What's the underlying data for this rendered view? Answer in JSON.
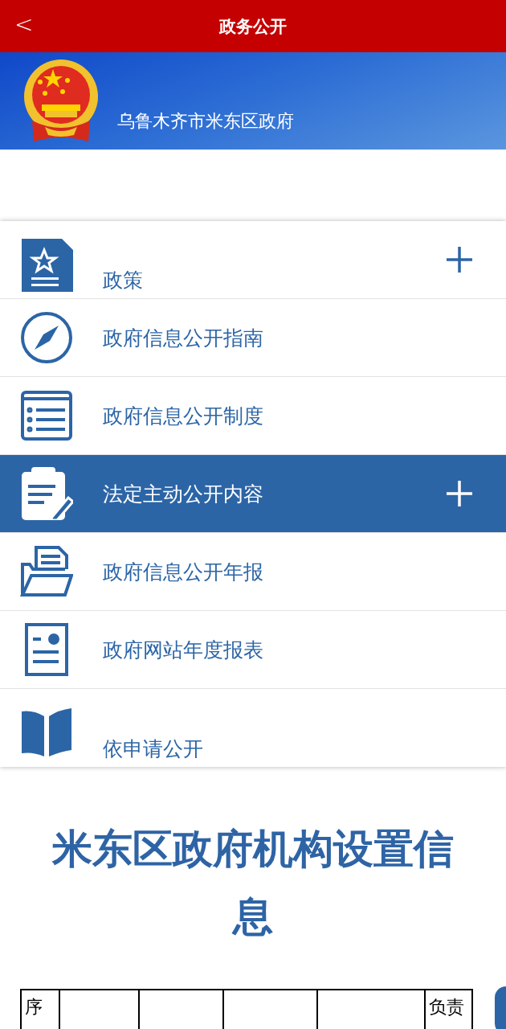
{
  "header": {
    "title": "政务公开",
    "back": "<"
  },
  "banner": {
    "title": "乌鲁木齐市米东区政府"
  },
  "menu": [
    {
      "label": "政策",
      "selected": false,
      "expandable": true
    },
    {
      "label": "政府信息公开指南",
      "selected": false,
      "expandable": false
    },
    {
      "label": "政府信息公开制度",
      "selected": false,
      "expandable": false
    },
    {
      "label": "法定主动公开内容",
      "selected": true,
      "expandable": true
    },
    {
      "label": "政府信息公开年报",
      "selected": false,
      "expandable": false
    },
    {
      "label": "政府网站年度报表",
      "selected": false,
      "expandable": false
    },
    {
      "label": "依申请公开",
      "selected": false,
      "expandable": false
    }
  ],
  "section_title": "米东区政府机构设置信息",
  "table": {
    "columns": [
      "序",
      "",
      "",
      "",
      "",
      "负责"
    ]
  }
}
